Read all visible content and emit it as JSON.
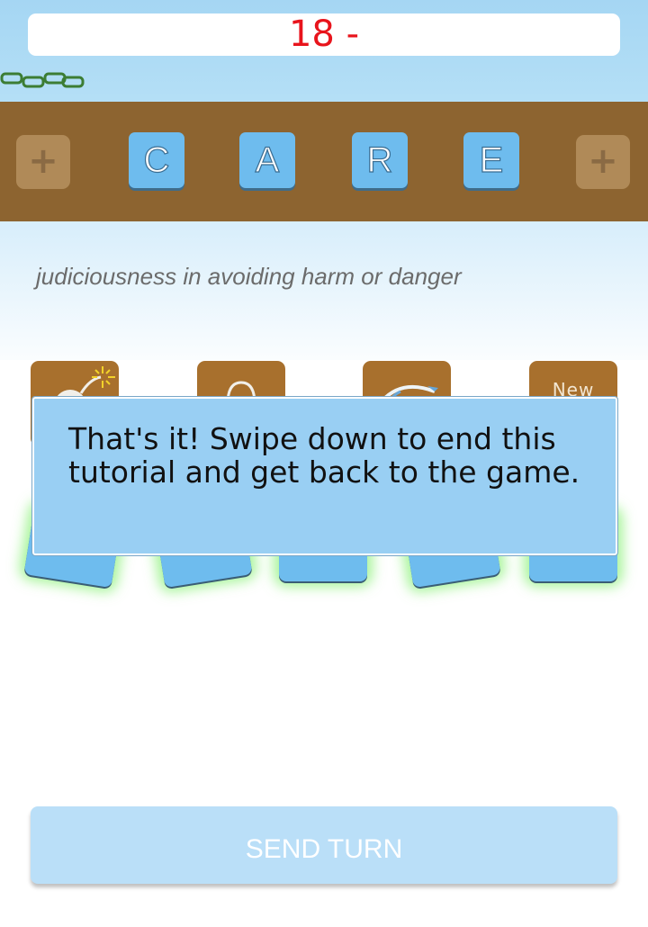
{
  "header": {
    "score": "18 -"
  },
  "board": {
    "left_plus": "+",
    "right_plus": "+",
    "letters": [
      "C",
      "A",
      "R",
      "E"
    ]
  },
  "clue": {
    "definition": "judiciousness in avoiding harm or danger"
  },
  "powerups": [
    {
      "icon": "bomb-icon",
      "label": ""
    },
    {
      "icon": "lightbulb-icon",
      "label": ""
    },
    {
      "icon": "refresh-icon",
      "label": ""
    },
    {
      "icon": "new-icon",
      "label": "New"
    }
  ],
  "tutorial": {
    "message": "That's it! Swipe down to end this tutorial and get back to the game."
  },
  "footer": {
    "send_label": "SEND TURN"
  },
  "colors": {
    "score": "#e8141c",
    "board": "#8d6430",
    "tile": "#6ebcee",
    "powerup": "#a8702d",
    "overlay": "#99cff3",
    "send_button": "#badff8"
  }
}
